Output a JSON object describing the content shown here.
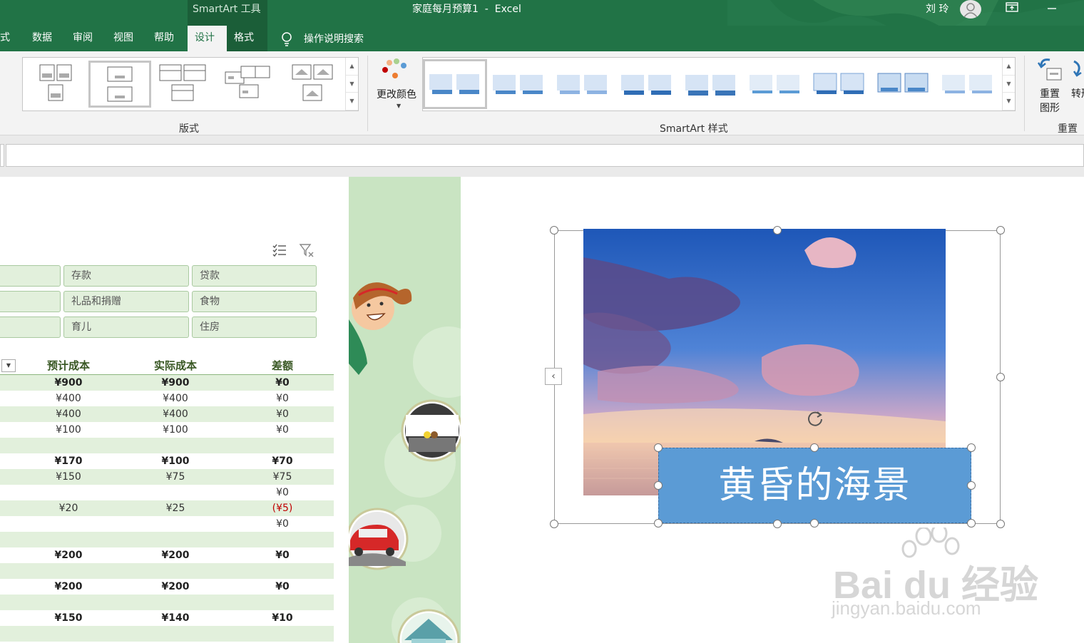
{
  "window": {
    "context_tab_group": "SmartArt 工具",
    "title": "家庭每月预算1  -  Excel",
    "user": "刘 玲"
  },
  "ribbon_tabs": [
    {
      "label": "式"
    },
    {
      "label": "数据"
    },
    {
      "label": "审阅"
    },
    {
      "label": "视图"
    },
    {
      "label": "帮助"
    },
    {
      "label": "设计"
    },
    {
      "label": "格式"
    }
  ],
  "tell_me": "操作说明搜索",
  "ribbon": {
    "layouts_label": "版式",
    "change_colors_label": "更改颜色",
    "styles_label": "SmartArt 样式",
    "reset_graphic_label": "重置图形",
    "convert_label": "转形",
    "reset_group_label": "重置"
  },
  "slicer": {
    "buttons": [
      {
        "label": ""
      },
      {
        "label": "存款"
      },
      {
        "label": "贷款"
      },
      {
        "label": ""
      },
      {
        "label": "礼品和捐赠"
      },
      {
        "label": "食物"
      },
      {
        "label": ""
      },
      {
        "label": "育儿"
      },
      {
        "label": "住房"
      }
    ]
  },
  "table": {
    "headers": [
      "预计成本",
      "实际成本",
      "差额"
    ],
    "rows": [
      {
        "cells": [
          "¥900",
          "¥900",
          "¥0"
        ],
        "bold": true,
        "band": true,
        "negative": false
      },
      {
        "cells": [
          "¥400",
          "¥400",
          "¥0"
        ],
        "bold": false,
        "band": false,
        "negative": false
      },
      {
        "cells": [
          "¥400",
          "¥400",
          "¥0"
        ],
        "bold": false,
        "band": true,
        "negative": false
      },
      {
        "cells": [
          "¥100",
          "¥100",
          "¥0"
        ],
        "bold": false,
        "band": false,
        "negative": false
      },
      {
        "cells": [
          "",
          "",
          ""
        ],
        "bold": false,
        "band": true,
        "negative": false
      },
      {
        "cells": [
          "¥170",
          "¥100",
          "¥70"
        ],
        "bold": true,
        "band": false,
        "negative": false
      },
      {
        "cells": [
          "¥150",
          "¥75",
          "¥75"
        ],
        "bold": false,
        "band": true,
        "negative": false
      },
      {
        "cells": [
          "",
          "",
          "¥0"
        ],
        "bold": false,
        "band": false,
        "negative": false
      },
      {
        "cells": [
          "¥20",
          "¥25",
          "(¥5)"
        ],
        "bold": false,
        "band": true,
        "negative": true
      },
      {
        "cells": [
          "",
          "",
          "¥0"
        ],
        "bold": false,
        "band": false,
        "negative": false
      },
      {
        "cells": [
          "",
          "",
          ""
        ],
        "bold": false,
        "band": true,
        "negative": false
      },
      {
        "cells": [
          "¥200",
          "¥200",
          "¥0"
        ],
        "bold": true,
        "band": false,
        "negative": false
      },
      {
        "cells": [
          "",
          "",
          ""
        ],
        "bold": false,
        "band": true,
        "negative": false
      },
      {
        "cells": [
          "¥200",
          "¥200",
          "¥0"
        ],
        "bold": true,
        "band": false,
        "negative": false
      },
      {
        "cells": [
          "",
          "",
          ""
        ],
        "bold": false,
        "band": true,
        "negative": false
      },
      {
        "cells": [
          "¥150",
          "¥140",
          "¥10"
        ],
        "bold": true,
        "band": false,
        "negative": false
      },
      {
        "cells": [
          "",
          "",
          ""
        ],
        "bold": false,
        "band": true,
        "negative": false
      }
    ]
  },
  "smartart": {
    "caption": "黄昏的海景"
  },
  "watermark": {
    "brand": "Bai du 经验",
    "url": "jingyan.baidu.com"
  },
  "colors": {
    "excel_green": "#217346",
    "context_green": "#1b5e38",
    "ribbon_bg": "#f3f3f3",
    "caption_blue": "#5b9bd5",
    "band_green": "#e2f0dc",
    "negative_red": "#c00000"
  }
}
